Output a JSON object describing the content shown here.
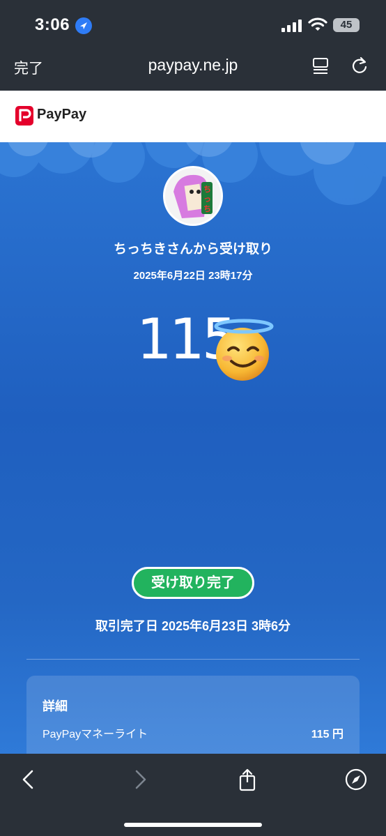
{
  "status_bar": {
    "time": "3:06",
    "battery": "45"
  },
  "browser": {
    "done_label": "完了",
    "url": "paypay.ne.jp"
  },
  "header": {
    "brand": "PayPay"
  },
  "receipt": {
    "sender": "ちっちきさんから受け取り",
    "date": "2025年6月22日 23時17分",
    "amount": "115",
    "status_badge": "受け取り完了",
    "completed_date": "取引完了日 2025年6月23日 3時6分"
  },
  "details": {
    "title": "詳細",
    "rows": [
      {
        "label": "PayPayマネーライト",
        "value": "115 円"
      }
    ]
  },
  "colors": {
    "accent_blue": "#2467c4",
    "success_green": "#22b35e",
    "brand_red": "#e4002b"
  }
}
